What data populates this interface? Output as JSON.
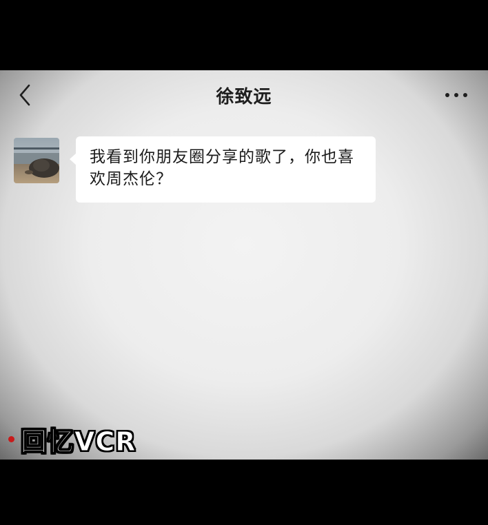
{
  "chat": {
    "title": "徐致远",
    "message": "我看到你朋友圈分享的歌了，你也喜欢周杰伦？"
  },
  "icons": {
    "back": "chevron-left-icon",
    "more": "more-dots-icon",
    "avatar": "avatar-photo"
  },
  "overlay": {
    "label": "回忆VCR",
    "dot_color": "#c81a1a"
  },
  "colors": {
    "letterbox": "#000000",
    "screen_bg": "#ededed",
    "bubble": "#ffffff",
    "text": "#1a1a1a"
  }
}
